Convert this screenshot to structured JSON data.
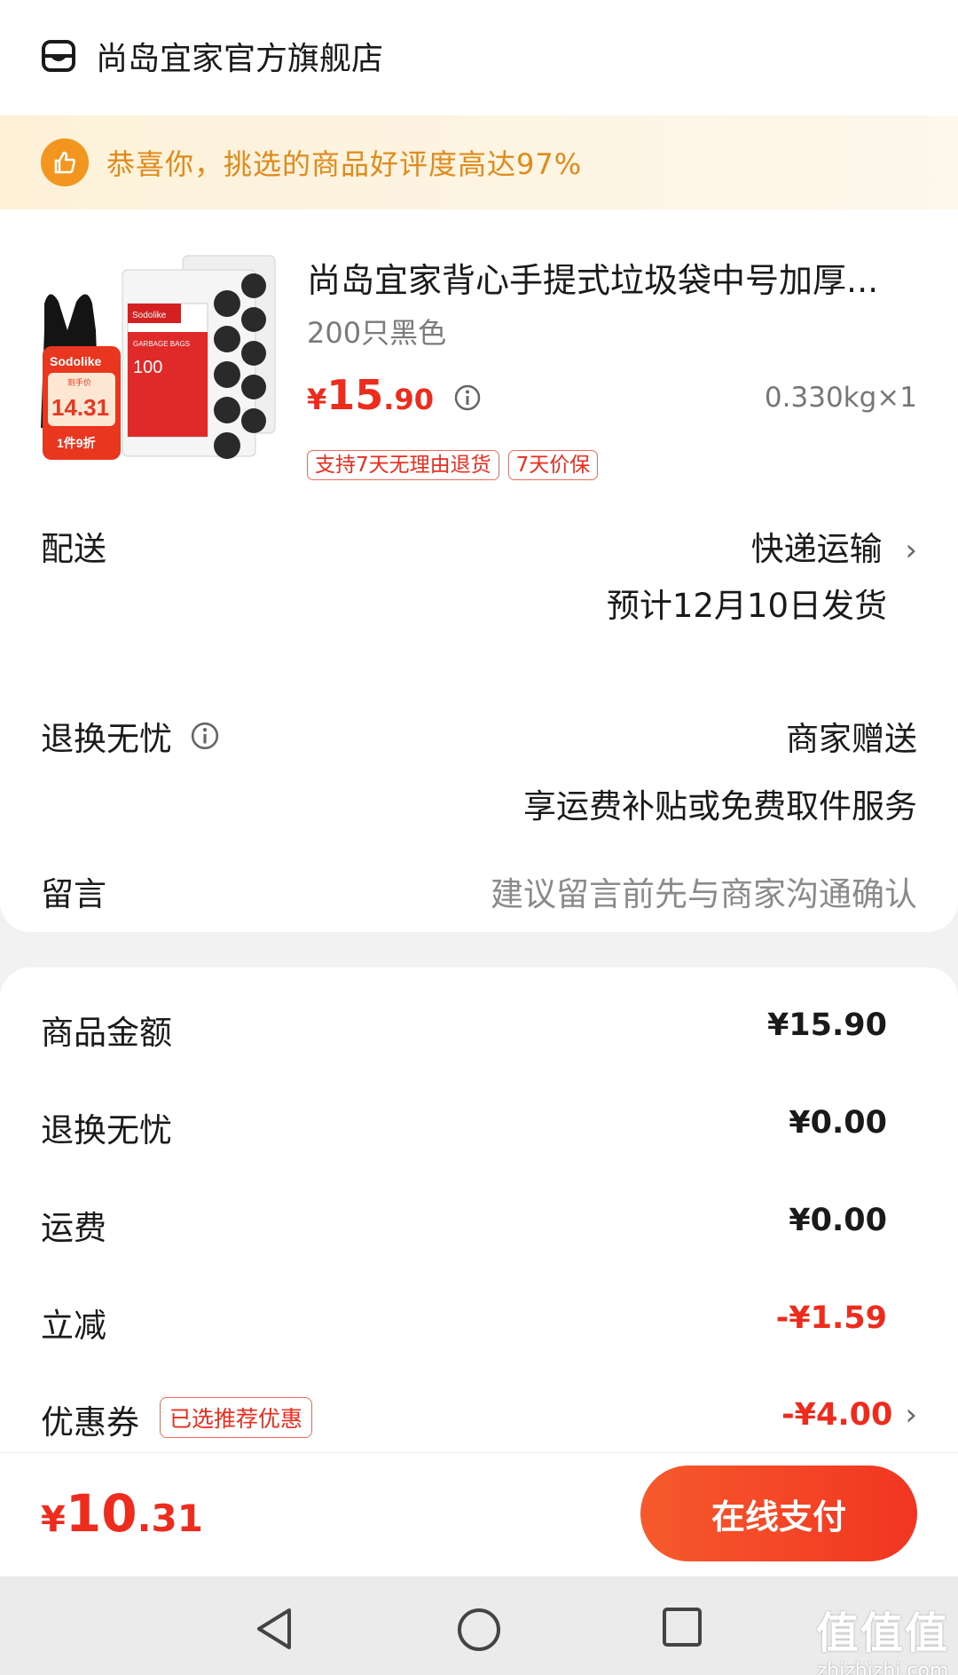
{
  "shop": {
    "name": "尚岛宜家官方旗舰店",
    "icon": "shop-icon"
  },
  "banner": {
    "icon": "thumbs-up-icon",
    "text": "恭喜你，挑选的商品好评度高达97%"
  },
  "product": {
    "title": "尚岛宜家背心手提式垃圾袋中号加厚...",
    "spec": "200只黑色",
    "price_symbol": "¥",
    "price_int": "15",
    "price_dec": ".90",
    "weight_qty": "0.330kg×1",
    "tags": [
      "支持7天无理由退货",
      "7天价保"
    ],
    "image": {
      "brand": "Sodolike",
      "badge_label": "到手价",
      "badge_price": "14.31",
      "badge_discount": "1件9折",
      "pack_count": "100",
      "pack_label": "GARBAGE BAGS"
    }
  },
  "delivery": {
    "label": "配送",
    "method": "快递运输",
    "estimate": "预计12月10日发货"
  },
  "returns": {
    "label": "退换无忧",
    "value": "商家赠送",
    "desc": "享运费补贴或免费取件服务"
  },
  "message": {
    "label": "留言",
    "placeholder": "建议留言前先与商家沟通确认"
  },
  "fees": {
    "goods": {
      "label": "商品金额",
      "value": "¥15.90"
    },
    "returns": {
      "label": "退换无忧",
      "value": "¥0.00"
    },
    "shipping": {
      "label": "运费",
      "value": "¥0.00"
    },
    "discount": {
      "label": "立减",
      "value": "-¥1.59"
    },
    "coupon": {
      "label": "优惠券",
      "tag": "已选推荐优惠",
      "value": "-¥4.00"
    }
  },
  "pay": {
    "total_symbol": "¥",
    "total_int": "10",
    "total_dec": ".31",
    "button": "在线支付"
  },
  "watermark": {
    "big": "值值值",
    "small": "zhizhizhi.com"
  },
  "colors": {
    "accent_red": "#ee2c1e",
    "banner_orange": "#e08a1a",
    "pay_button": "#f13521"
  }
}
